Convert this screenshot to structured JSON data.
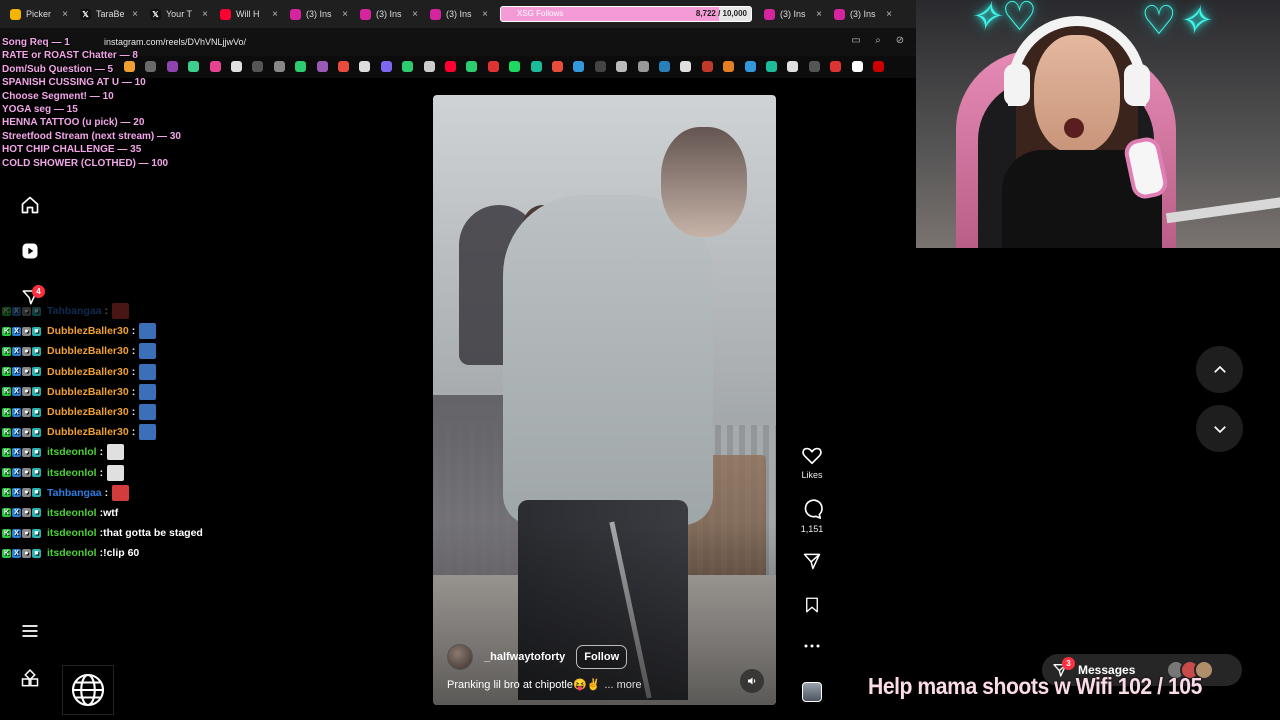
{
  "browser": {
    "tabs": [
      {
        "title": "Picker",
        "icon_color": "#f4b400",
        "icon": "circle-icon"
      },
      {
        "title": "TaraBe",
        "icon_color": "#111111",
        "icon": "x-icon"
      },
      {
        "title": "Your T",
        "icon_color": "#111111",
        "icon": "x-icon"
      },
      {
        "title": "Will H",
        "icon_color": "#ff0033",
        "icon": "youtube-icon"
      },
      {
        "title": "(3) Ins",
        "icon_color": "#d6249f",
        "icon": "instagram-icon"
      },
      {
        "title": "(3) Ins",
        "icon_color": "#d6249f",
        "icon": "instagram-icon"
      },
      {
        "title": "(3) Ins",
        "icon_color": "#d6249f",
        "icon": "instagram-icon"
      }
    ],
    "tabs_right": [
      {
        "title": "(3) Ins",
        "icon_color": "#d6249f",
        "icon": "instagram-icon"
      },
      {
        "title": "(3) Ins",
        "icon_color": "#d6249f",
        "icon": "instagram-icon"
      }
    ],
    "url": "instagram.com/reels/DVhVNLjjwVo/"
  },
  "follow_goal": {
    "label": "XSG Follows",
    "count": "8,722 / 10,000",
    "progress": 0.8722,
    "fill_color": "#f49ad6"
  },
  "stream_menu": [
    "Song Req — 1",
    "RATE or ROAST Chatter — 8",
    "Dom/Sub Question — 5",
    "SPANISH CUSSING AT U — 10",
    "Choose Segment! — 10",
    "YOGA seg — 15",
    "HENNA TATTOO (u pick) — 20",
    "Streetfood Stream (next stream) — 30",
    "HOT CHIP CHALLENGE — 35",
    "COLD SHOWER (CLOTHED) — 100"
  ],
  "sidebar": {
    "notification_count": "4"
  },
  "chat": [
    {
      "user": "Tahbangaa",
      "color": "#2d7de0",
      "msg": "",
      "emote": "#d33c3c",
      "faded": true
    },
    {
      "user": "DubblezBaller30",
      "color": "#f0a030",
      "msg": "",
      "emote": "#3b6fb8"
    },
    {
      "user": "DubblezBaller30",
      "color": "#f0a030",
      "msg": "",
      "emote": "#3b6fb8"
    },
    {
      "user": "DubblezBaller30",
      "color": "#f0a030",
      "msg": "",
      "emote": "#3b6fb8"
    },
    {
      "user": "DubblezBaller30",
      "color": "#f0a030",
      "msg": "",
      "emote": "#3b6fb8"
    },
    {
      "user": "DubblezBaller30",
      "color": "#f0a030",
      "msg": "",
      "emote": "#3b6fb8"
    },
    {
      "user": "DubblezBaller30",
      "color": "#f0a030",
      "msg": "",
      "emote": "#3b6fb8"
    },
    {
      "user": "itsdeonlol",
      "color": "#4cd137",
      "msg": "",
      "emote": "#e0e0e0"
    },
    {
      "user": "itsdeonlol",
      "color": "#4cd137",
      "msg": "",
      "emote": "#e0e0e0"
    },
    {
      "user": "Tahbangaa",
      "color": "#2d7de0",
      "msg": "",
      "emote": "#d33c3c"
    },
    {
      "user": "itsdeonlol",
      "color": "#4cd137",
      "msg": "wtf",
      "emote": null
    },
    {
      "user": "itsdeonlol",
      "color": "#4cd137",
      "msg": "that gotta be staged",
      "emote": null
    },
    {
      "user": "itsdeonlol",
      "color": "#4cd137",
      "msg": "!clip 60",
      "emote": null
    }
  ],
  "reel": {
    "username": "_halfwaytoforty",
    "follow_label": "Follow",
    "caption": "Pranking lil bro at chipotle😝✌️",
    "more_label": "... more"
  },
  "actions": {
    "likes_label": "Likes",
    "comments_count": "1,151"
  },
  "messages": {
    "label": "Messages",
    "badge": "3"
  },
  "wifi_goal": "Help mama shoots w Wifi  102 / 105"
}
